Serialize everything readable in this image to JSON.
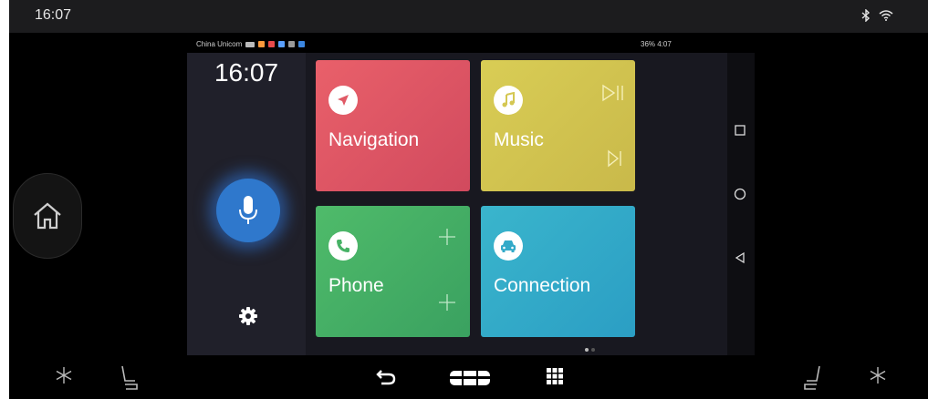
{
  "topbar": {
    "clock": "16:07"
  },
  "phone": {
    "status_carrier": "China Unicom",
    "status_right": "36% 4:07",
    "clock": "16:07",
    "tiles": [
      {
        "label": "Navigation",
        "color": "#e05a66",
        "icon": "navigation-arrow-icon"
      },
      {
        "label": "Music",
        "color": "#d4c752",
        "icon": "music-note-icon"
      },
      {
        "label": "Phone",
        "color": "#47b266",
        "icon": "phone-icon"
      },
      {
        "label": "Connection",
        "color": "#33aac9",
        "icon": "car-icon"
      }
    ],
    "page_indicator": {
      "count": 2,
      "active": 1
    }
  },
  "colors": {
    "mic_blue": "#2f78cc"
  }
}
